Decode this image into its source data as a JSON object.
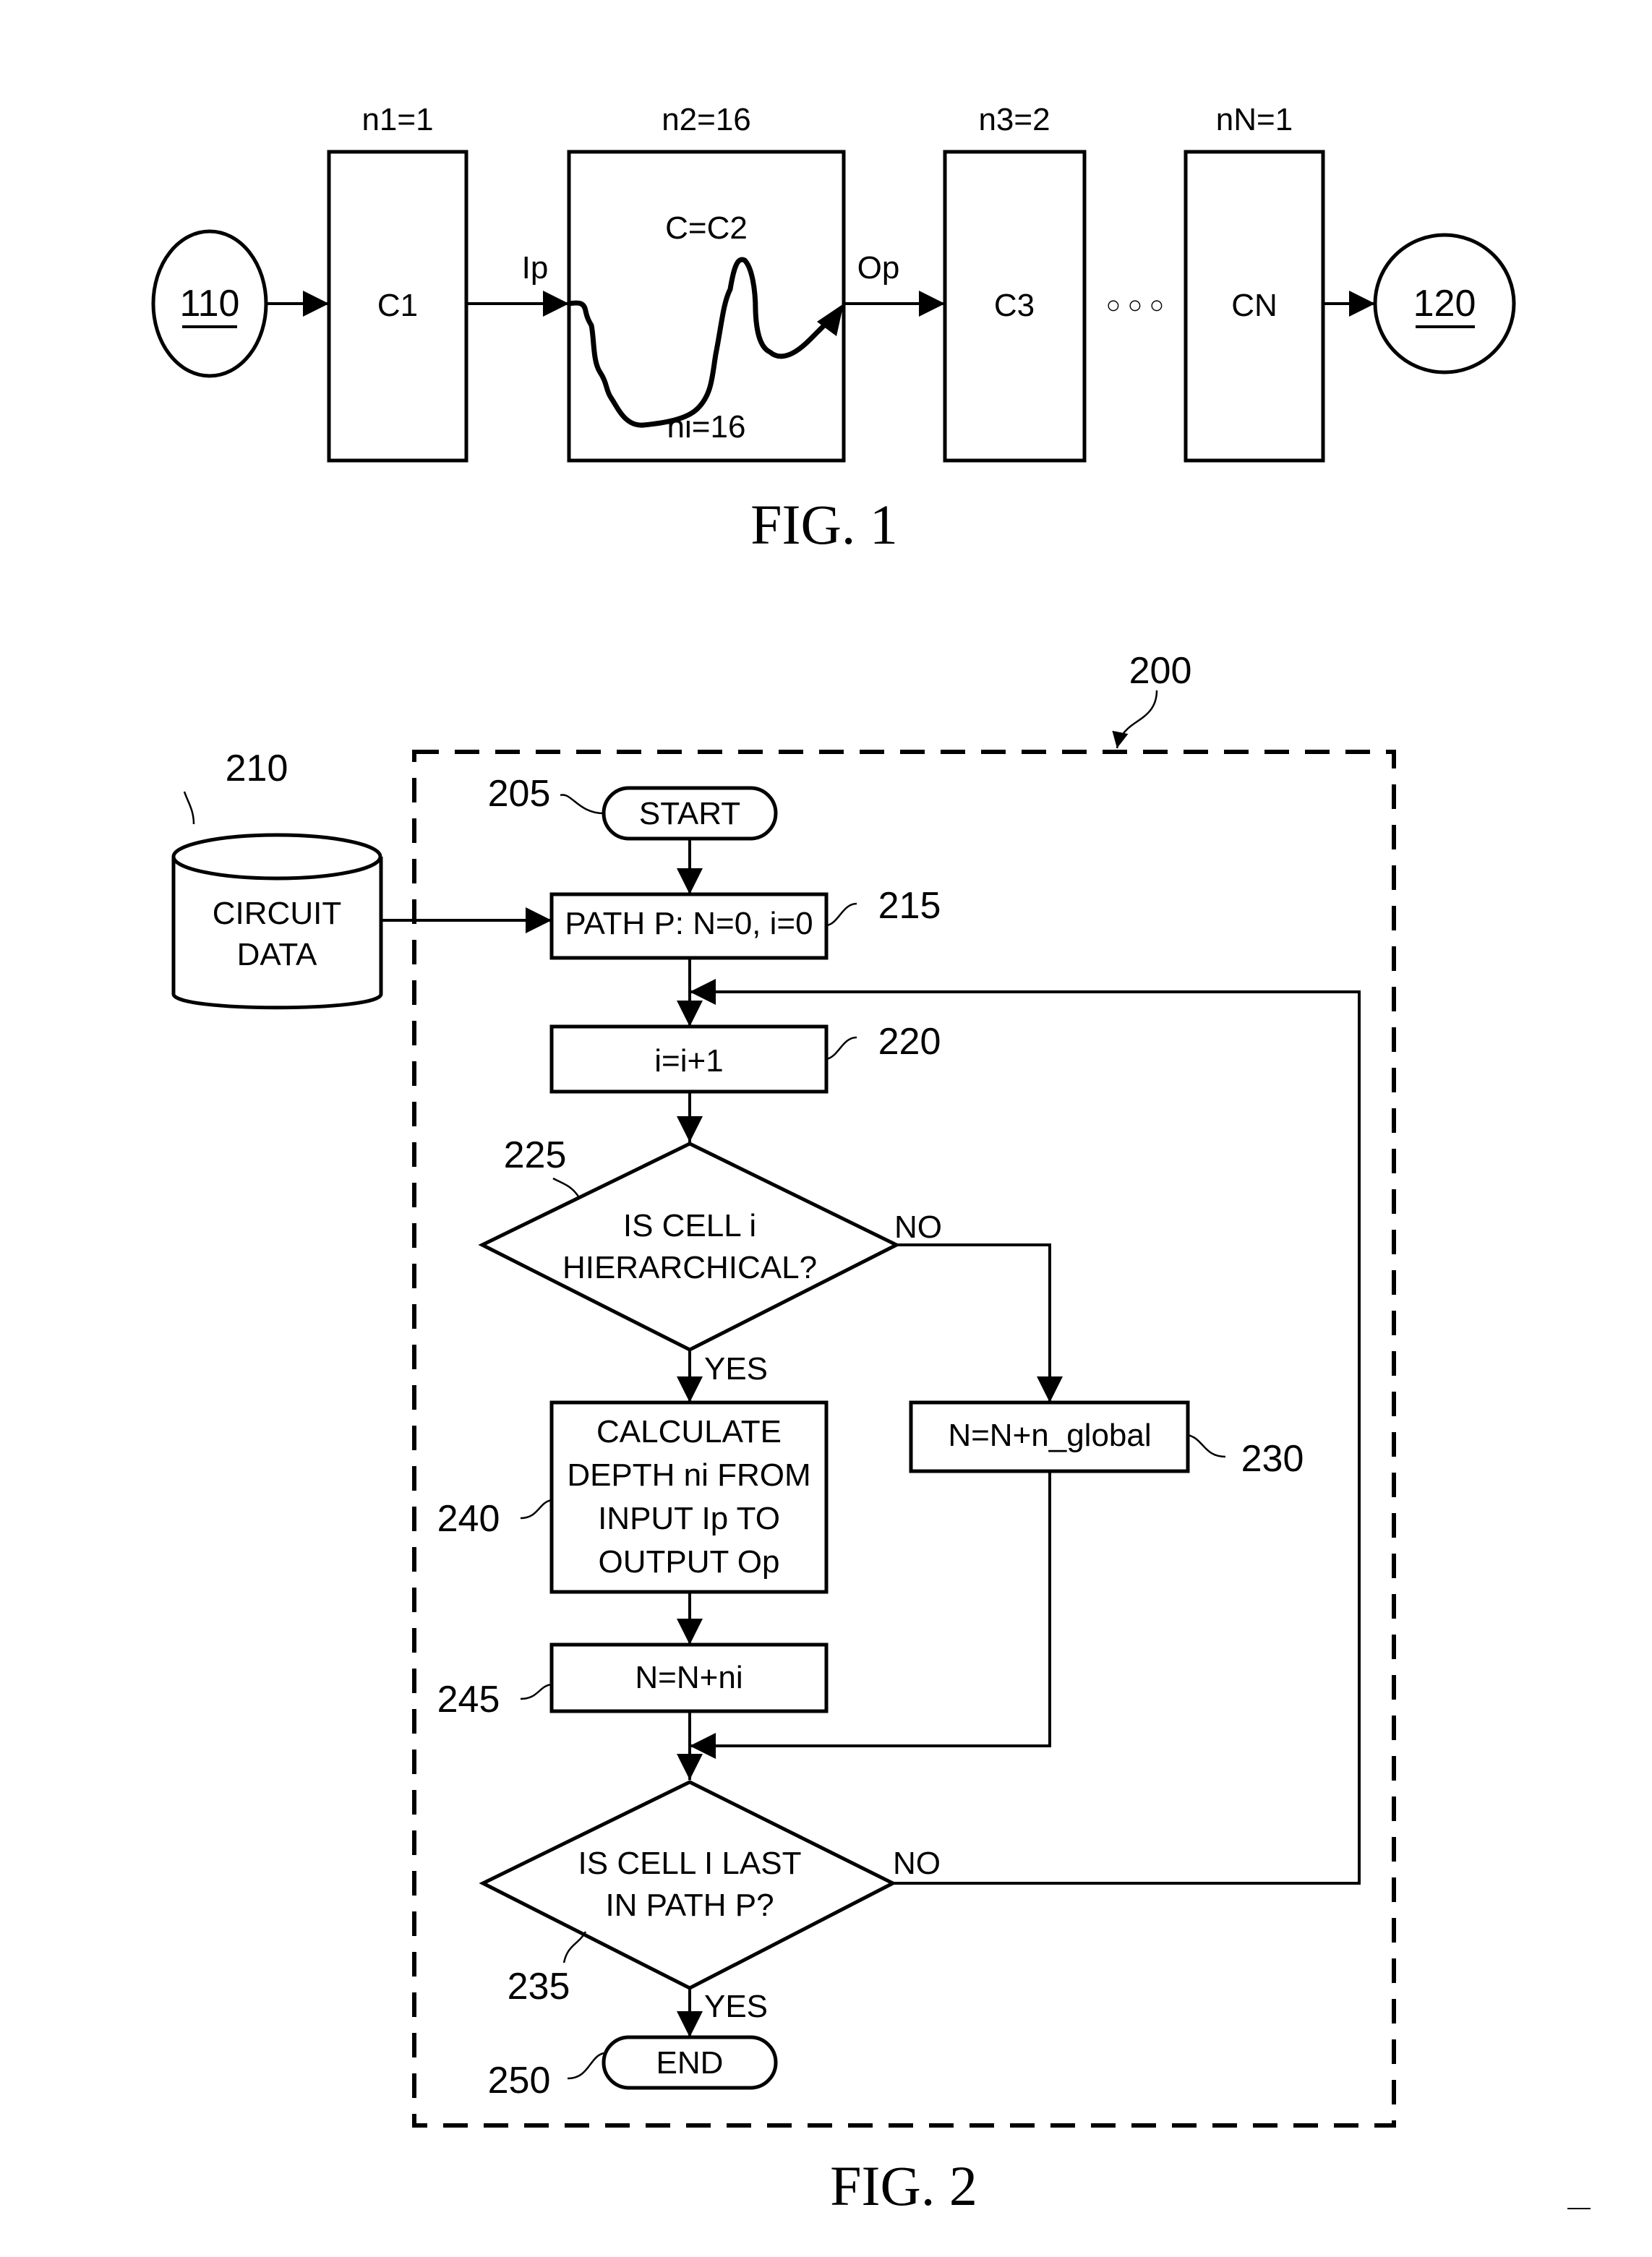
{
  "fig1": {
    "caption": "FIG. 1",
    "source_node": "110",
    "sink_node": "120",
    "cells": [
      {
        "label": "C1",
        "depth_label": "n1=1"
      },
      {
        "label": "C=C2",
        "depth_label": "n2=16",
        "inner_depth": "ni=16"
      },
      {
        "label": "C3",
        "depth_label": "n3=2"
      },
      {
        "label": "CN",
        "depth_label": "nN=1"
      }
    ],
    "input_pin": "Ip",
    "output_pin": "Op",
    "ellipsis": "○ ○ ○"
  },
  "fig2": {
    "caption": "FIG. 2",
    "ref_method": "200",
    "database": {
      "ref": "210",
      "line1": "CIRCUIT",
      "line2": "DATA"
    },
    "start": {
      "ref": "205",
      "label": "START"
    },
    "init": {
      "ref": "215",
      "label": "PATH P: N=0, i=0"
    },
    "increment": {
      "ref": "220",
      "label": "i=i+1"
    },
    "decision1": {
      "ref": "225",
      "line1": "IS CELL i",
      "line2": "HIERARCHICAL?",
      "no": "NO",
      "yes": "YES"
    },
    "global_step": {
      "ref": "230",
      "label": "N=N+n_global"
    },
    "calc_step": {
      "ref": "240",
      "lines": [
        "CALCULATE",
        "DEPTH ni FROM",
        "INPUT Ip TO",
        "OUTPUT Op"
      ]
    },
    "accum_step": {
      "ref": "245",
      "label": "N=N+ni"
    },
    "decision2": {
      "ref": "235",
      "line1": "IS CELL I LAST",
      "line2": "IN PATH P?",
      "no": "NO",
      "yes": "YES"
    },
    "end": {
      "ref": "250",
      "label": "END"
    }
  }
}
